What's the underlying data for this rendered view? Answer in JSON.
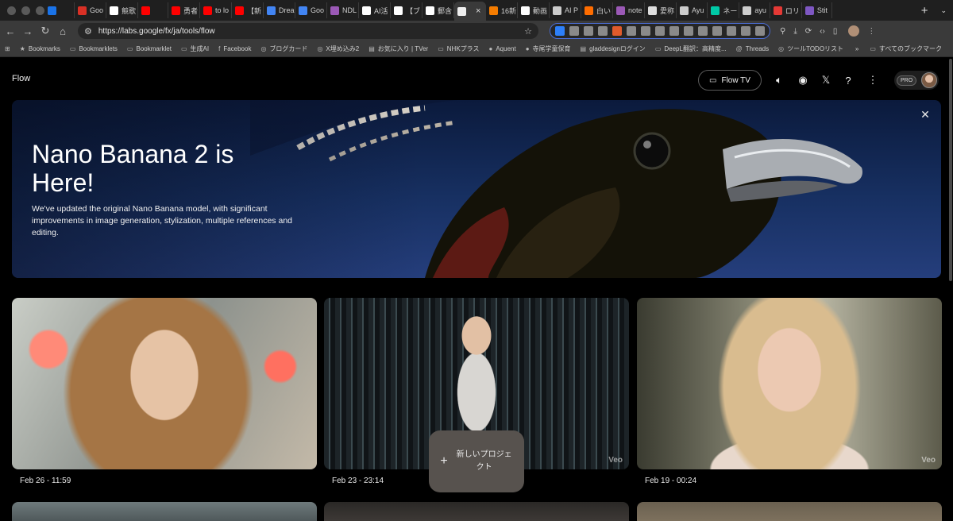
{
  "browser": {
    "tabs": [
      {
        "label": "",
        "color": "#1a73e8"
      },
      {
        "label": "Goo",
        "color": "#d93025"
      },
      {
        "label": "競歌",
        "color": "#ffffff"
      },
      {
        "label": "",
        "color": "#ff0000"
      },
      {
        "label": "勇者",
        "color": "#ff0000"
      },
      {
        "label": "to lo",
        "color": "#ff0000"
      },
      {
        "label": "【新",
        "color": "#ff0000"
      },
      {
        "label": "Drea",
        "color": "#4285f4"
      },
      {
        "label": "Goo",
        "color": "#4285f4"
      },
      {
        "label": "NDL",
        "color": "#9b59b6"
      },
      {
        "label": "AI活",
        "color": "#ffffff"
      },
      {
        "label": "【ブ",
        "color": "#ffffff"
      },
      {
        "label": "郵含",
        "color": "#ffffff"
      },
      {
        "label": "",
        "color": "#eeeeee",
        "active": true
      },
      {
        "label": "16新",
        "color": "#f57c00"
      },
      {
        "label": "動画",
        "color": "#ffffff"
      },
      {
        "label": "AI P",
        "color": "#cccccc"
      },
      {
        "label": "白い",
        "color": "#ff6d00"
      },
      {
        "label": "note",
        "color": "#9b59b6"
      },
      {
        "label": "愛称",
        "color": "#dddddd"
      },
      {
        "label": "Ayu",
        "color": "#cccccc"
      },
      {
        "label": "ネー",
        "color": "#00c9a7"
      },
      {
        "label": "ayu",
        "color": "#cccccc"
      },
      {
        "label": "ロリ",
        "color": "#e53935"
      },
      {
        "label": "Stit",
        "color": "#7e57c2"
      }
    ],
    "url": "https://labs.google/fx/ja/tools/flow",
    "bookmarks": [
      {
        "icon": "★",
        "label": "Bookmarks"
      },
      {
        "icon": "▭",
        "label": "Bookmarklets"
      },
      {
        "icon": "▭",
        "label": "Bookmarklet"
      },
      {
        "icon": "▭",
        "label": "生成AI"
      },
      {
        "icon": "f",
        "label": "Facebook"
      },
      {
        "icon": "◎",
        "label": "ブログカード"
      },
      {
        "icon": "◎",
        "label": "X埋め込み2"
      },
      {
        "icon": "▤",
        "label": "お気に入り | TVer"
      },
      {
        "icon": "▭",
        "label": "NHKプラス"
      },
      {
        "icon": "●",
        "label": "Aquent"
      },
      {
        "icon": "●",
        "label": "寺尾学童保育"
      },
      {
        "icon": "▤",
        "label": "gladdesignログイン"
      },
      {
        "icon": "▭",
        "label": "DeepL翻訳：高精度..."
      },
      {
        "icon": "@",
        "label": "Threads"
      },
      {
        "icon": "◎",
        "label": "ツールTODOリスト"
      }
    ],
    "all_bookmarks": "すべてのブックマーク"
  },
  "header": {
    "title": "Flow",
    "flow_tv": "Flow TV",
    "pro": "PRO"
  },
  "hero": {
    "title": "Nano Banana 2 is Here!",
    "description": "We've updated the original Nano Banana model, with significant improvements in image generation, stylization, multiple references and editing."
  },
  "cards": [
    {
      "date": "Feb 26 - 11:59",
      "badge": ""
    },
    {
      "date": "Feb 23 - 23:14",
      "badge": "Veo"
    },
    {
      "date": "Feb 19 - 00:24",
      "badge": "Veo"
    }
  ],
  "new_project": {
    "label": "新しいプロジェクト"
  },
  "colors": {
    "page_bg": "#000000",
    "hero_bg": "#1b3266",
    "button_bg": "#57524e"
  }
}
